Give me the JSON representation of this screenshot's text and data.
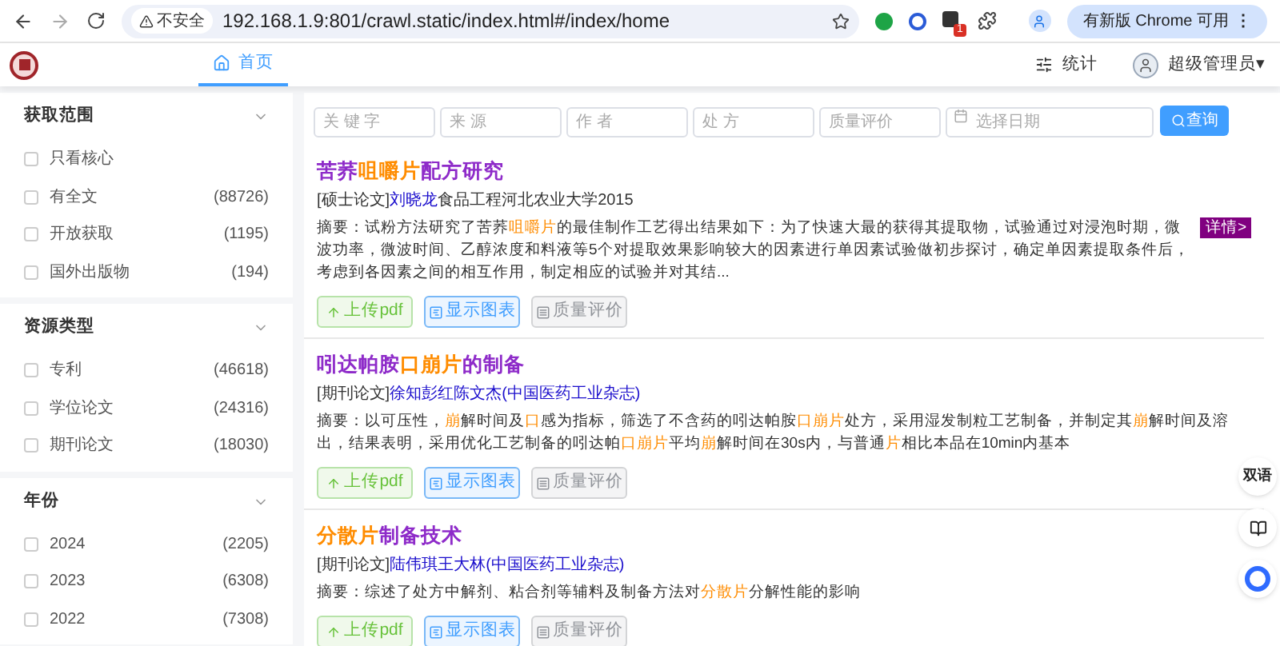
{
  "browser": {
    "security": "不安全",
    "url": "192.168.1.9:801/crawl.static/index.html#/index/home",
    "extension_badge": "1",
    "update": "有新版 Chrome 可用",
    "menu": "⋮"
  },
  "header": {
    "tabs": [
      {
        "label": "首页",
        "selected": true
      }
    ],
    "stats": "统计",
    "user": "超级管理员",
    "user_caret": "▾"
  },
  "sidebar": [
    {
      "title": "获取范围",
      "items": [
        {
          "label": "只看核心",
          "checked": false
        },
        {
          "label": "有全文",
          "count": "(88726)",
          "checked": false
        },
        {
          "label": "开放获取",
          "count": "(1195)",
          "checked": false
        },
        {
          "label": "国外出版物",
          "count": "(194)",
          "checked": false
        }
      ]
    },
    {
      "title": "资源类型",
      "items": [
        {
          "label": "专利",
          "count": "(46618)",
          "checked": false
        },
        {
          "label": "学位论文",
          "count": "(24316)",
          "checked": false
        },
        {
          "label": "期刊论文",
          "count": "(18030)",
          "checked": false
        }
      ]
    },
    {
      "title": "年份",
      "items": [
        {
          "label": "2024",
          "count": "(2205)",
          "checked": false
        },
        {
          "label": "2023",
          "count": "(6308)",
          "checked": false
        },
        {
          "label": "2022",
          "count": "(7308)",
          "checked": false
        }
      ]
    }
  ],
  "search": {
    "fields": [
      {
        "placeholder": "关 键 字"
      },
      {
        "placeholder": "来 源"
      },
      {
        "placeholder": "作 者"
      },
      {
        "placeholder": "处 方"
      },
      {
        "placeholder": "质量评价"
      },
      {
        "placeholder": "选择日期",
        "kind": "date"
      }
    ],
    "button": "查询"
  },
  "results": [
    {
      "title": [
        {
          "text": "苦荞",
          "highlight": false
        },
        {
          "text": "咀嚼片",
          "highlight": true
        },
        {
          "text": "配方研究",
          "highlight": false
        }
      ],
      "meta": [
        {
          "text": "[硕士论文]",
          "link": false
        },
        {
          "text": "刘晓龙",
          "link": true
        },
        {
          "text": "食品工程河北农业大学2015",
          "link": false
        }
      ],
      "abstract": [
        {
          "text": "摘要：试粉方法研究了苦荞",
          "highlight": false
        },
        {
          "text": "咀嚼片",
          "highlight": true
        },
        {
          "text": "的最佳制作工艺得出结果如下：为了快速大最的获得其提取物，试验通过对浸泡时期，微波功率，微波时间、乙醇浓度和料液等5个对提取效果影响较大的因素进行单因素试验做初步探讨，确定单因素提取条件后，考虑到各因素之间的相互作用，制定相应的试验并对其结...",
          "highlight": false
        }
      ],
      "detail": "详情>",
      "buttons": [
        {
          "label": "上传pdf",
          "kind": "upload"
        },
        {
          "label": "显示图表",
          "kind": "chart"
        },
        {
          "label": "质量评价",
          "kind": "rating"
        }
      ]
    },
    {
      "title": [
        {
          "text": "吲达帕胺",
          "highlight": false
        },
        {
          "text": "口崩片",
          "highlight": true
        },
        {
          "text": "的制备",
          "highlight": false
        }
      ],
      "meta": [
        {
          "text": "[期刊论文]",
          "link": false
        },
        {
          "text": "徐知彭红陈文杰(中国医药工业杂志)",
          "link": true
        }
      ],
      "abstract": [
        {
          "text": "摘要：以可压性，",
          "highlight": false
        },
        {
          "text": "崩",
          "highlight": true
        },
        {
          "text": "解时间及",
          "highlight": false
        },
        {
          "text": "口",
          "highlight": true
        },
        {
          "text": "感为指标，筛选了不含药的吲达帕胺",
          "highlight": false
        },
        {
          "text": "口崩片",
          "highlight": true
        },
        {
          "text": "处方，采用湿发制粒工艺制备，并制定其",
          "highlight": false
        },
        {
          "text": "崩",
          "highlight": true
        },
        {
          "text": "解时间及溶出，结果表明，采用优化工艺制备的吲达帕",
          "highlight": false
        },
        {
          "text": "口崩片",
          "highlight": true
        },
        {
          "text": "平均",
          "highlight": false
        },
        {
          "text": "崩",
          "highlight": true
        },
        {
          "text": "解时间在30s内，与普通",
          "highlight": false
        },
        {
          "text": "片",
          "highlight": true
        },
        {
          "text": "相比本品在10min内基本",
          "highlight": false
        }
      ],
      "buttons": [
        {
          "label": "上传pdf",
          "kind": "upload"
        },
        {
          "label": "显示图表",
          "kind": "chart"
        },
        {
          "label": "质量评价",
          "kind": "rating"
        }
      ]
    },
    {
      "title": [
        {
          "text": "分散片",
          "highlight": true
        },
        {
          "text": "制备技术",
          "highlight": false
        }
      ],
      "meta": [
        {
          "text": "[期刊论文]",
          "link": false
        },
        {
          "text": "陆伟琪王大林(中国医药工业杂志)",
          "link": true
        }
      ],
      "abstract": [
        {
          "text": "摘要：综述了处方中解剂、粘合剂等辅料及制备方法对",
          "highlight": false
        },
        {
          "text": "分散片",
          "highlight": true
        },
        {
          "text": "分解性能的影响",
          "highlight": false
        }
      ],
      "buttons": [
        {
          "label": "上传pdf",
          "kind": "upload"
        },
        {
          "label": "显示图表",
          "kind": "chart"
        },
        {
          "label": "质量评价",
          "kind": "rating"
        }
      ]
    }
  ],
  "float_tools": {
    "translate": "双语"
  }
}
